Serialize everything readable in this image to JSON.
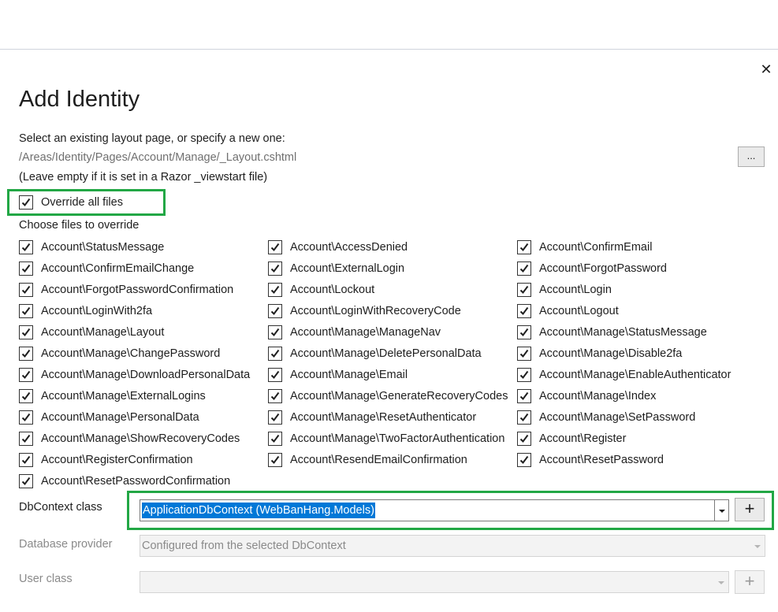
{
  "dialog": {
    "title": "Add Identity",
    "close_symbol": "✕"
  },
  "layout": {
    "prompt": "Select an existing layout page, or specify a new one:",
    "path": "/Areas/Identity/Pages/Account/Manage/_Layout.cshtml",
    "browse_label": "...",
    "hint": "(Leave empty if it is set in a Razor _viewstart file)"
  },
  "override_all": {
    "label": "Override all files",
    "checked": true
  },
  "files_heading": "Choose files to override",
  "files": [
    [
      "Account\\StatusMessage",
      "Account\\AccessDenied",
      "Account\\ConfirmEmail"
    ],
    [
      "Account\\ConfirmEmailChange",
      "Account\\ExternalLogin",
      "Account\\ForgotPassword"
    ],
    [
      "Account\\ForgotPasswordConfirmation",
      "Account\\Lockout",
      "Account\\Login"
    ],
    [
      "Account\\LoginWith2fa",
      "Account\\LoginWithRecoveryCode",
      "Account\\Logout"
    ],
    [
      "Account\\Manage\\Layout",
      "Account\\Manage\\ManageNav",
      "Account\\Manage\\StatusMessage"
    ],
    [
      "Account\\Manage\\ChangePassword",
      "Account\\Manage\\DeletePersonalData",
      "Account\\Manage\\Disable2fa"
    ],
    [
      "Account\\Manage\\DownloadPersonalData",
      "Account\\Manage\\Email",
      "Account\\Manage\\EnableAuthenticator"
    ],
    [
      "Account\\Manage\\ExternalLogins",
      "Account\\Manage\\GenerateRecoveryCodes",
      "Account\\Manage\\Index"
    ],
    [
      "Account\\Manage\\PersonalData",
      "Account\\Manage\\ResetAuthenticator",
      "Account\\Manage\\SetPassword"
    ],
    [
      "Account\\Manage\\ShowRecoveryCodes",
      "Account\\Manage\\TwoFactorAuthentication",
      "Account\\Register"
    ],
    [
      "Account\\RegisterConfirmation",
      "Account\\ResendEmailConfirmation",
      "Account\\ResetPassword"
    ],
    [
      "Account\\ResetPasswordConfirmation"
    ]
  ],
  "dbcontext": {
    "label": "DbContext class",
    "value": "ApplicationDbContext (WebBanHang.Models)",
    "add_label": "+"
  },
  "db_provider": {
    "label": "Database provider",
    "value": "Configured from the selected DbContext"
  },
  "user_class": {
    "label": "User class",
    "value": "",
    "add_label": "+"
  },
  "colors": {
    "highlight": "#22a745",
    "selection": "#0078d7",
    "text": "#1e1e1e",
    "muted": "#707070"
  }
}
